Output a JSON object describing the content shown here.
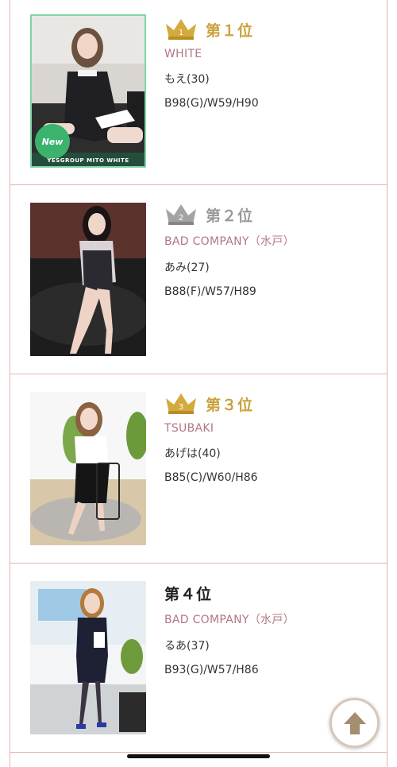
{
  "rankings": [
    {
      "rank_text": "第１位",
      "crown": "gold-crown-icon",
      "crown_number": "1",
      "shop": "WHITE",
      "name": "もえ(30)",
      "size": "B98(G)/W59/H90",
      "badge_text": "New",
      "photo_caption": "YESGROUP MITO WHITE"
    },
    {
      "rank_text": "第２位",
      "crown": "silver-crown-icon",
      "crown_number": "2",
      "shop": "BAD COMPANY（水戸）",
      "name": "あみ(27)",
      "size": "B88(F)/W57/H89"
    },
    {
      "rank_text": "第３位",
      "crown": "bronze-crown-icon",
      "crown_number": "3",
      "shop": "TSUBAKI",
      "name": "あげは(40)",
      "size": "B85(C)/W60/H86"
    },
    {
      "rank_text": "第４位",
      "shop": "BAD COMPANY（水戸）",
      "name": "るあ(37)",
      "size": "B93(G)/W57/H86"
    }
  ],
  "colors": {
    "gold": "#c9a23b",
    "silver": "#9a9a9a",
    "border": "#e6b3ad",
    "shop": "#b07882"
  },
  "scroll_top_icon": "arrow-up-icon"
}
